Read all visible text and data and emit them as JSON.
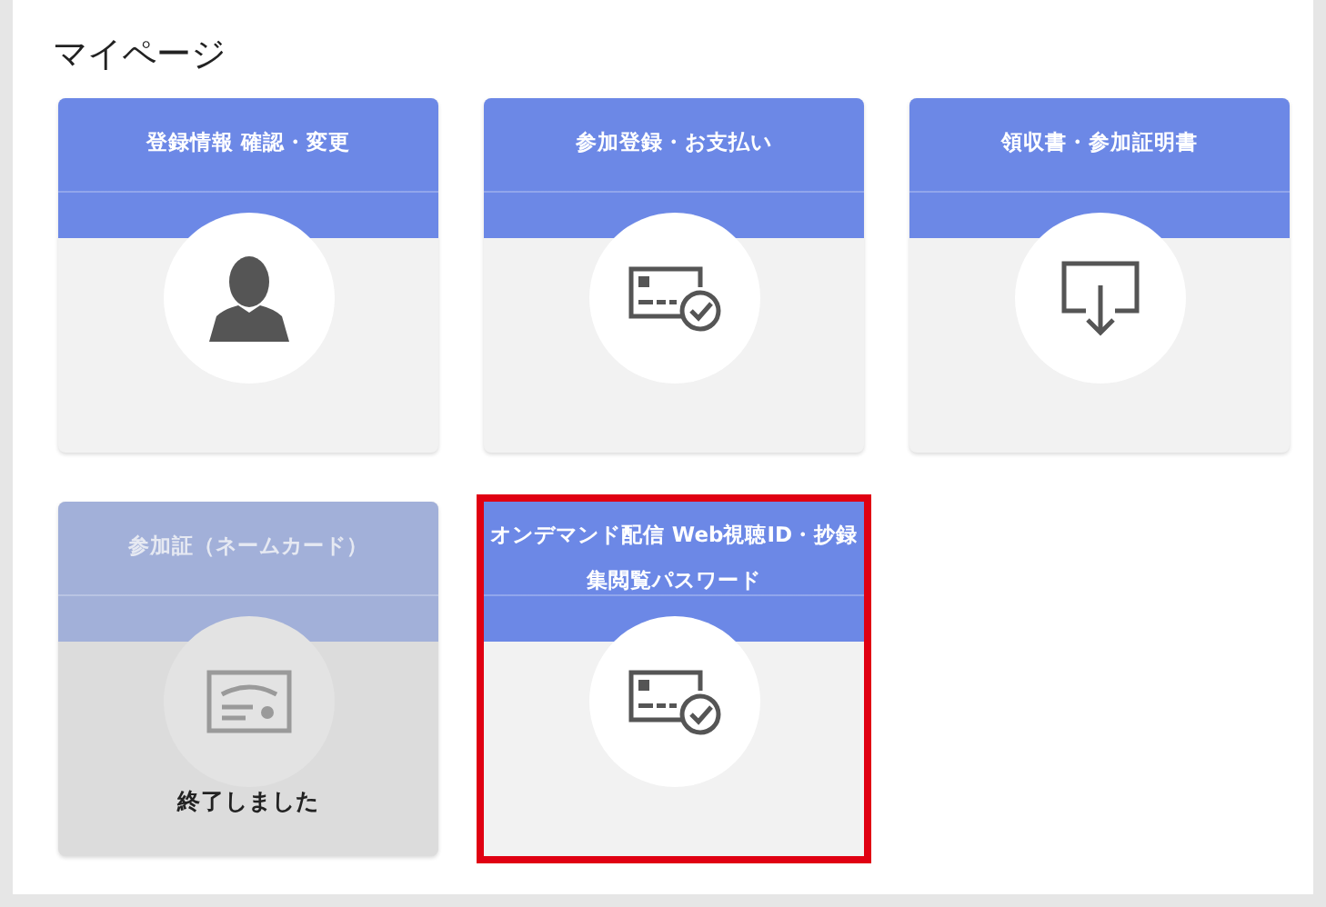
{
  "page_title": "マイページ",
  "cards": [
    {
      "title": "登録情報 確認・変更",
      "kind": "person",
      "disabled": false,
      "selected": false
    },
    {
      "title": "参加登録・お支払い",
      "kind": "card-check",
      "disabled": false,
      "selected": false
    },
    {
      "title": "領収書・参加証明書",
      "kind": "download",
      "disabled": false,
      "selected": false
    },
    {
      "title": "参加証（ネームカード）",
      "kind": "name-card",
      "disabled": true,
      "selected": false,
      "status": "終了しました"
    },
    {
      "title": "オンデマンド配信 Web視聴ID・抄録集閲覧パスワード",
      "kind": "card-check",
      "disabled": false,
      "selected": true
    }
  ]
}
